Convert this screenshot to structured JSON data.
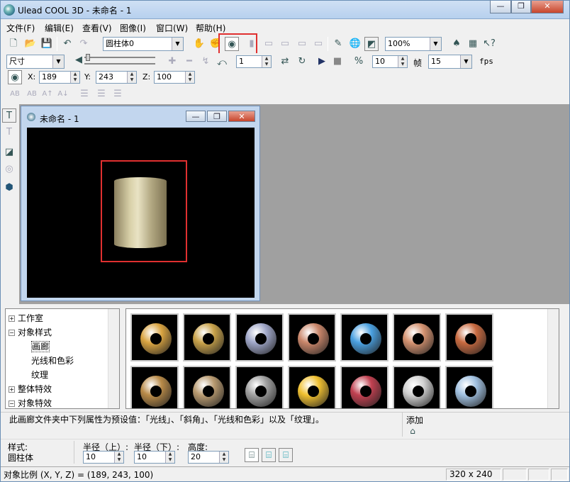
{
  "window": {
    "title": "Ulead COOL 3D - 未命名 - 1",
    "min": "—",
    "max": "❐",
    "close": "✕"
  },
  "menu": [
    "文件(F)",
    "编辑(E)",
    "查看(V)",
    "图像(I)",
    "窗口(W)",
    "帮助(H)"
  ],
  "toolbar1": {
    "object_combo": "圆柱体0",
    "zoom_combo": "100%"
  },
  "toolbar2": {
    "attr_combo": "尺寸",
    "frame_value": "1",
    "frames_total": "10",
    "frame_label": "帧",
    "fps_value": "15",
    "fps_label": "fps"
  },
  "toolbar3": {
    "x_label": "X:",
    "x_value": "189",
    "y_label": "Y:",
    "y_value": "243",
    "z_label": "Z:",
    "z_value": "100"
  },
  "doc": {
    "title": "未命名 - 1",
    "min": "—",
    "max": "❐",
    "close": "✕"
  },
  "tree": {
    "items": [
      "工作室",
      "对象样式",
      "画廊",
      "光线和色彩",
      "纹理",
      "整体特效",
      "对象特效"
    ],
    "signs": [
      "+",
      "−",
      "+",
      "−"
    ]
  },
  "gallery_colors": [
    "#d9a441",
    "#c8a24a",
    "#9fa6c8",
    "#c9866a",
    "#4aa0e0",
    "#d49270",
    "#c86a40",
    "#b88a48",
    "#b89a70",
    "#a0a0a0",
    "#f0c030",
    "#c04050",
    "#d0d0d0",
    "#a0c0e0"
  ],
  "desc": {
    "text": "此画廊文件夹中下列属性为预设值：「光线」、「斜角」、「光线和色彩」以及「纹理」。",
    "add_label": "添加"
  },
  "props": {
    "style_label": "样式:",
    "style_value": "圆柱体",
    "r_top_label": "半径（上）:",
    "r_top_value": "10",
    "r_bottom_label": "半径（下）:",
    "r_bottom_value": "10",
    "height_label": "高度:",
    "height_value": "20"
  },
  "status": {
    "text": "对象比例 (X, Y, Z) = (189, 243, 100)",
    "size": "320 x 240"
  }
}
